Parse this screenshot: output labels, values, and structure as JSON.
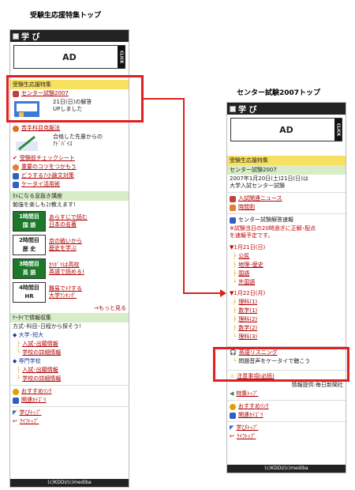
{
  "left": {
    "title": "受験生応援特集トップ",
    "app_name": "学 び",
    "ad": "AD",
    "ad_click": "CLICK",
    "feature_bar": "受験生応援特集",
    "center_link": "センター試験2007",
    "answers_line1": "21日(日)の解答",
    "answers_line2": "UPしました",
    "senpai_link": "苦手科目克服法",
    "senpai_line1": "合格した先輩からの",
    "senpai_line2": "ｱﾄﾞﾊﾞｲｽ",
    "links": [
      "受験前チェックシート",
      "重要のコツをつかもう",
      "どうする?小論文対策",
      "ケータイ活用術"
    ],
    "lecture_bar": "ﾀﾒになる息抜き講座",
    "lecture_sub": "勉強を楽しもｺﾂ教えます!",
    "courses": [
      {
        "line1": "1時間目",
        "line2": "国 語",
        "text1": "あらすじで読む",
        "text2": "日本の名著"
      },
      {
        "line1": "2時間目",
        "line2": "歴 史",
        "text1": "京の戦いから",
        "text2": "歴史を学ぶ"
      },
      {
        "line1": "3時間目",
        "line2": "英 語",
        "text1": "ｶﾘﾎﾞﾘは高校",
        "text2": "英語で読める!"
      },
      {
        "line1": "4時間目",
        "line2": "HR",
        "text1": "難易でﾄｸする",
        "text2": "大学ﾗﾝｷﾝｸﾞ"
      }
    ],
    "more": "→もっと見る",
    "info_bar": "ｹｰﾀｲで情報収集",
    "info_sub": "方式･科目･日程から探そう!",
    "univ_label": "◆ 大学･短大",
    "univ_links": [
      "入試･出願情報",
      "学校の詳細情報"
    ],
    "senmon_label": "◆ 専門学校",
    "senmon_links": [
      "入試･出願情報",
      "学校の詳細情報"
    ],
    "rec_link": "おすすめﾘﾝｸ",
    "cat_link": "関連ｶﾃｺﾞﾘ",
    "manabi_top": "学びﾄｯﾌﾟ",
    "life_top": "ﾗｲﾌﾄｯﾌﾟ",
    "footer": "(c)KDDI/(c)mediba"
  },
  "right": {
    "title": "センター試験2007トップ",
    "app_name": "学 び",
    "ad": "AD",
    "ad_click": "CLICK",
    "feature_bar": "受験生応援特集",
    "center_bar": "センター試験2007",
    "date_line1": "2007年1月20日(土)21日(日)は",
    "date_line2": "大学入試センター試験",
    "news_link": "入試関連ニュース",
    "schedule_link": "時間割",
    "answer_title": "センター試験解答速報",
    "answer_note1": "※試験当日の20時過ぎに正解･配点",
    "answer_note2": "を速報予定です。",
    "day1": "▼1月21日(日)",
    "day1_links": [
      "公民",
      "地理･歴史",
      "国語",
      "外国語"
    ],
    "day2": "▼1月22日(月)",
    "day2_links": [
      "理科(1)",
      "数学(1)",
      "理科(2)",
      "数学(2)",
      "理科(3)"
    ],
    "listening_link": "英語リスニング",
    "listening_desc": "問題音声をケータイで聴こう",
    "notice": "注意事項(必読)",
    "provider": "情報提供:毎日新聞社",
    "feature_top": "特集ﾄｯﾌﾟ",
    "rec_link": "おすすめﾘﾝｸ",
    "cat_link": "関連ｶﾃｺﾞﾘ",
    "manabi_top": "学びﾄｯﾌﾟ",
    "life_top": "ﾗｲﾌﾄｯﾌﾟ",
    "footer": "(c)KDDI/(c)mediba"
  },
  "colors": {
    "highlight": "#e02020",
    "yellow_bar": "#f8e060",
    "green_bar": "#d8ecc8",
    "link": "#b00000",
    "course_green": "#1a7a2a"
  }
}
